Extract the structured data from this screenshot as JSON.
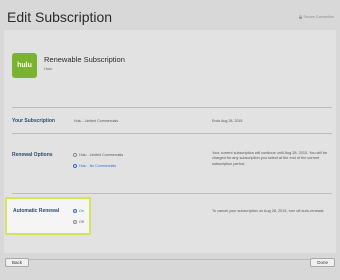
{
  "header": {
    "title": "Edit Subscription",
    "secure_label": "Secure Connection"
  },
  "app": {
    "name": "Renewable Subscription",
    "subtitle": "Hulu",
    "logo_text": "hulu"
  },
  "your_subscription": {
    "label": "Your Subscription",
    "plan": "Hulu - Limited Commercials",
    "ends": "Ends Aug 28, 2015"
  },
  "renewal": {
    "label": "Renewal Options",
    "options": [
      {
        "label": "Hulu - Limited Commercials",
        "selected": false
      },
      {
        "label": "Hulu - No Commercials",
        "selected": true
      }
    ],
    "note": "Your current subscription will continue until Aug 28, 2015. You will be charged for any subscription you select at the end of the current subscription period."
  },
  "auto_renewal": {
    "label": "Automatic Renewal",
    "options": [
      {
        "label": "On",
        "selected": true
      },
      {
        "label": "Off",
        "selected": false
      }
    ],
    "note": "To cancel your subscription on Aug 28, 2015, turn off auto-renewal."
  },
  "footer": {
    "back_label": "Back",
    "done_label": "Done"
  },
  "colors": {
    "accent": "#2f6fd6",
    "highlight": "#d6e35a",
    "brand": "#7ab32e"
  }
}
